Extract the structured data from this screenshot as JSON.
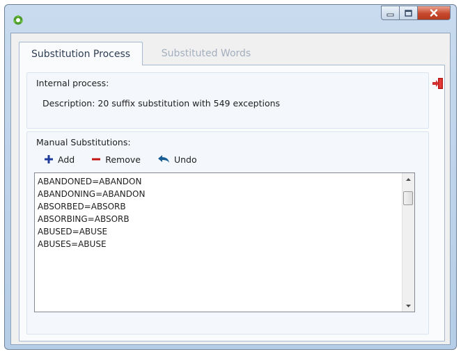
{
  "window": {
    "icon": "app-icon",
    "buttons": {
      "minimize": "minimize-icon",
      "maximize": "maximize-icon",
      "close": "close-icon"
    }
  },
  "tabs": [
    {
      "label": "Substitution Process",
      "active": true
    },
    {
      "label": "Substituted Words",
      "active": false
    }
  ],
  "internal": {
    "label": "Internal process:",
    "description": "Description: 20 suffix substitution with 549 exceptions",
    "exit_icon": "exit-icon"
  },
  "manual": {
    "label": "Manual Substitutions:",
    "toolbar": {
      "add": "Add",
      "remove": "Remove",
      "undo": "Undo"
    },
    "entries": [
      "ABANDONED=ABANDON",
      "ABANDONING=ABANDON",
      "ABSORBED=ABSORB",
      "ABSORBING=ABSORB",
      "ABUSED=ABUSE",
      "ABUSES=ABUSE"
    ]
  },
  "colors": {
    "add": "#1f3c9c",
    "remove": "#c41414",
    "undo": "#1a5e96",
    "close_button": "#c84a2e",
    "title_bar": "#c0d5eb"
  }
}
